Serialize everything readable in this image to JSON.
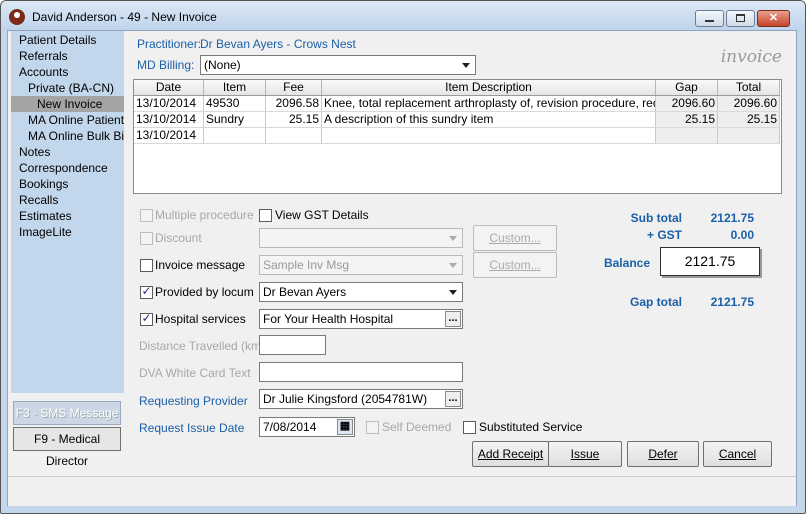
{
  "window": {
    "title": "David Anderson - 49 - New Invoice"
  },
  "sidebar": {
    "items": [
      {
        "label": "Patient Details"
      },
      {
        "label": "Referrals"
      },
      {
        "label": "Accounts"
      },
      {
        "label": "Private (BA-CN)"
      },
      {
        "label": "New Invoice"
      },
      {
        "label": "MA Online Patient C"
      },
      {
        "label": "MA Online Bulk Bill ("
      },
      {
        "label": "Notes"
      },
      {
        "label": "Correspondence"
      },
      {
        "label": "Bookings"
      },
      {
        "label": "Recalls"
      },
      {
        "label": "Estimates"
      },
      {
        "label": "ImageLite"
      }
    ],
    "sms_button": "F3 - SMS Message",
    "md_button": "F9 - Medical Director"
  },
  "header": {
    "practitioner_label": "Practitioner:",
    "practitioner_value": "Dr Bevan Ayers - Crows Nest",
    "md_billing_label": "MD Billing:",
    "md_billing_value": "(None)",
    "watermark": "invoice"
  },
  "table": {
    "columns": [
      "Date",
      "Item",
      "Fee",
      "Item Description",
      "Gap",
      "Total"
    ],
    "rows": [
      [
        "13/10/2014",
        "49530",
        "2096.58",
        "Knee, total replacement arthroplasty of, revision procedure, requiring...",
        "2096.60",
        "2096.60"
      ],
      [
        "13/10/2014",
        "Sundry",
        "25.15",
        "A description of this sundry item",
        "25.15",
        "25.15"
      ],
      [
        "13/10/2014",
        "",
        "",
        "",
        "",
        ""
      ]
    ]
  },
  "form": {
    "multiple_procedure": "Multiple procedure",
    "view_gst": "View GST Details",
    "discount": "Discount",
    "custom1": "Custom...",
    "invoice_message": "Invoice message",
    "invoice_message_value": "Sample Inv Msg",
    "custom2": "Custom...",
    "provided_by_locum": "Provided by locum",
    "locum_value": "Dr Bevan Ayers",
    "hospital_services": "Hospital services",
    "hospital_value": "For Your Health Hospital",
    "distance_label": "Distance Travelled (km)",
    "dva_label": "DVA White Card Text",
    "requesting_provider_label": "Requesting Provider",
    "requesting_provider_value": "Dr Julie Kingsford (2054781W)",
    "request_issue_date_label": "Request Issue Date",
    "request_issue_date_value": "7/08/2014",
    "self_deemed": "Self Deemed",
    "substituted_service": "Substituted Service"
  },
  "totals": {
    "sub_total_label": "Sub total",
    "sub_total_value": "2121.75",
    "gst_label": "+ GST",
    "gst_value": "0.00",
    "balance_label": "Balance",
    "balance_value": "2121.75",
    "gap_total_label": "Gap total",
    "gap_total_value": "2121.75"
  },
  "actions": {
    "add_receipt": "Add Receipt",
    "issue": "Issue",
    "defer": "Defer",
    "cancel": "Cancel"
  }
}
